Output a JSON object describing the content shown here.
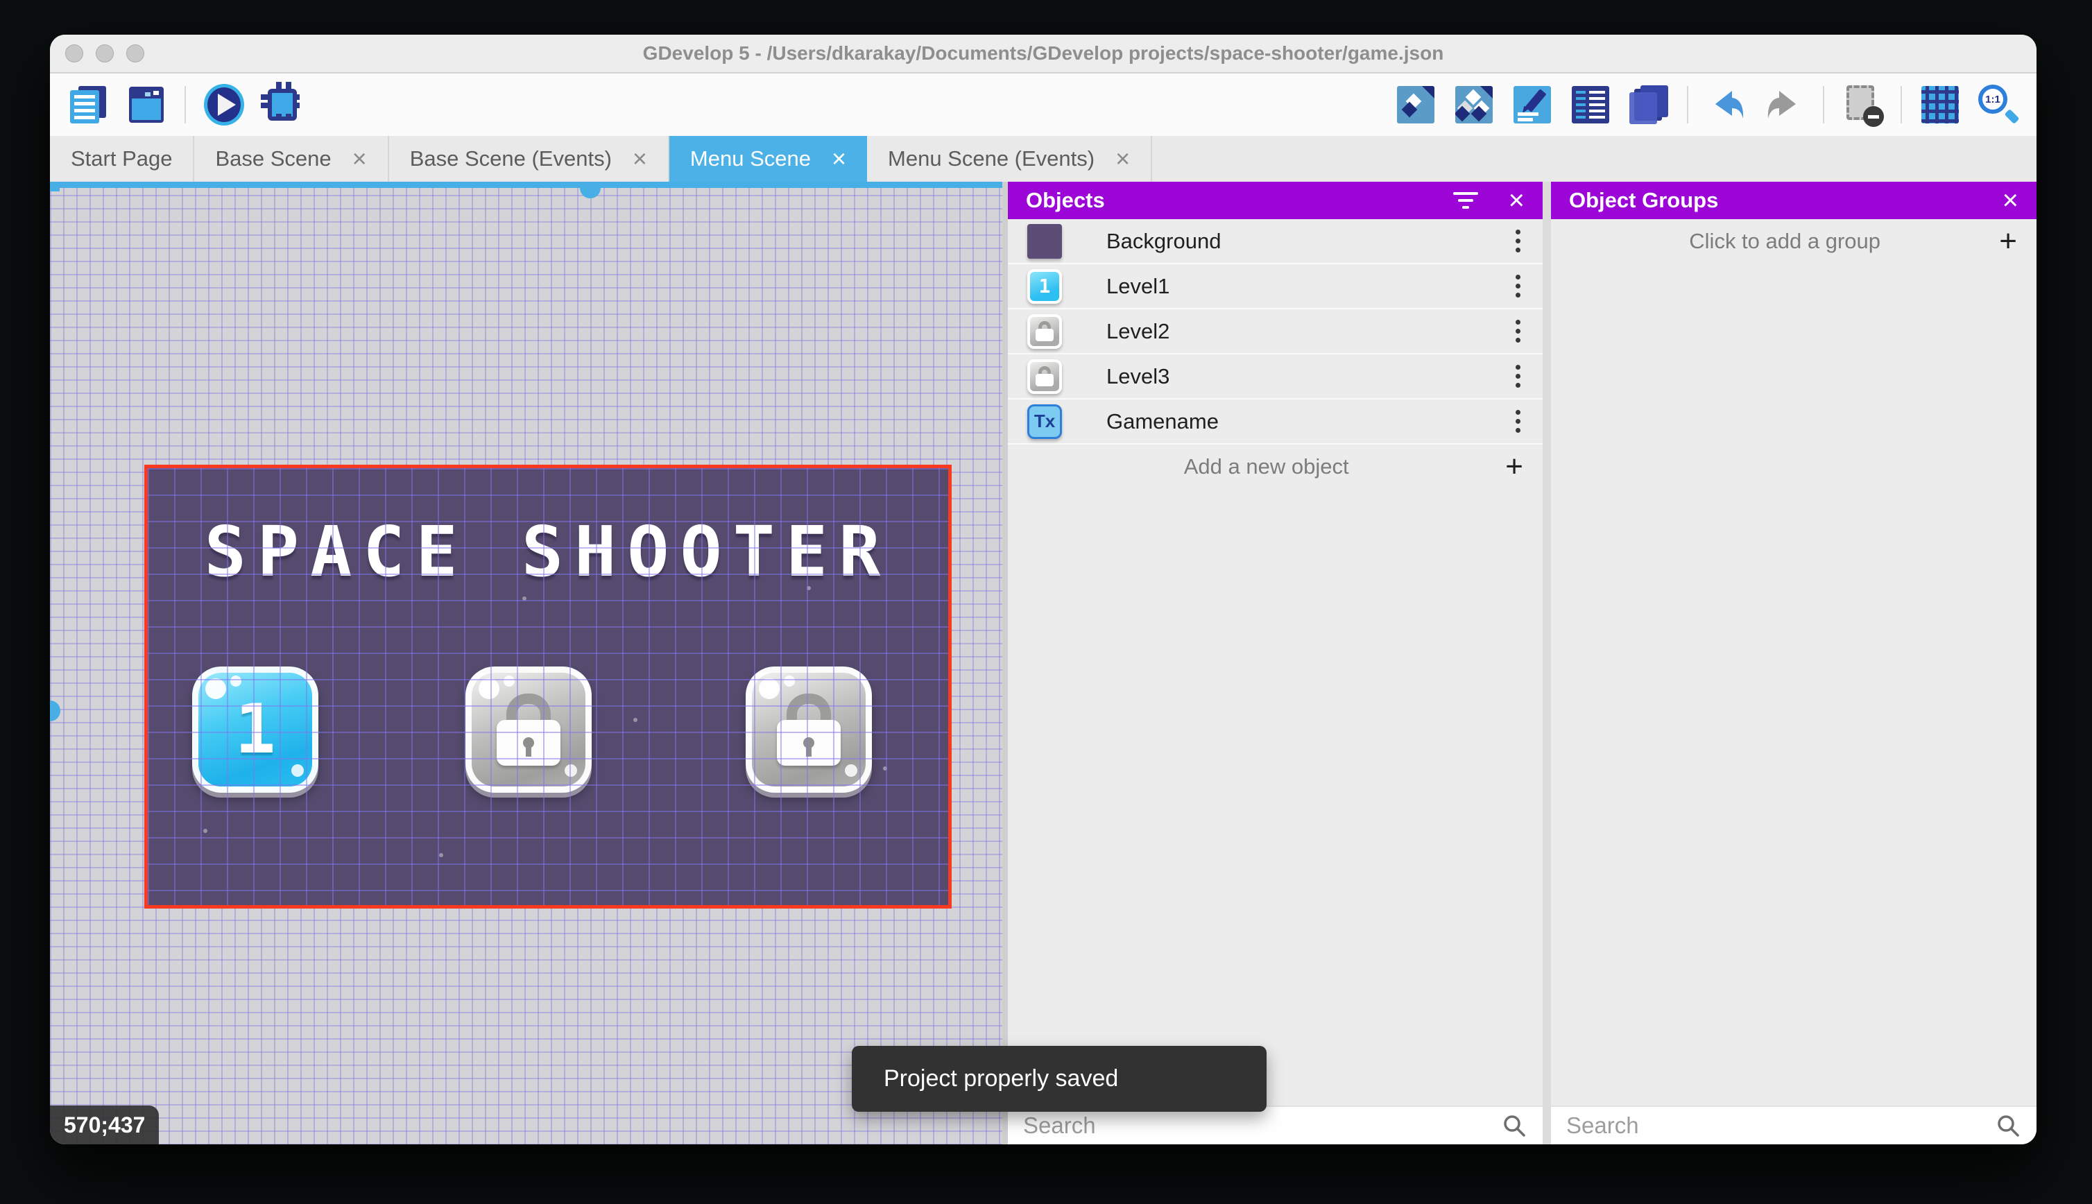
{
  "window": {
    "title": "GDevelop 5 - /Users/dkarakay/Documents/GDevelop projects/space-shooter/game.json",
    "traffic_lights": [
      "close",
      "minimize",
      "zoom"
    ]
  },
  "toolbar": {
    "left_icons": [
      "project-manager-icon",
      "preview-window-icon",
      "play-icon",
      "debug-icon"
    ],
    "right_icons": [
      "object-icon",
      "object-groups-icon",
      "edit-properties-icon",
      "instances-list-icon",
      "layers-icon",
      "undo-icon",
      "redo-icon",
      "mask-icon",
      "grid-icon",
      "zoom-1-1-icon"
    ],
    "zoom_ratio_label": "1:1"
  },
  "tabs": [
    {
      "label": "Start Page",
      "closable": false,
      "active": false
    },
    {
      "label": "Base Scene",
      "closable": true,
      "active": false
    },
    {
      "label": "Base Scene (Events)",
      "closable": true,
      "active": false
    },
    {
      "label": "Menu Scene",
      "closable": true,
      "active": true
    },
    {
      "label": "Menu Scene (Events)",
      "closable": true,
      "active": false
    }
  ],
  "glyphs": {
    "close": "×",
    "plus": "+"
  },
  "canvas": {
    "coordinates": "570;437",
    "toast": "Project properly saved",
    "scene": {
      "title": "SPACE SHOOTER",
      "buttons": [
        {
          "type": "level",
          "label": "1"
        },
        {
          "type": "locked",
          "label": ""
        },
        {
          "type": "locked",
          "label": ""
        }
      ]
    }
  },
  "objects_panel": {
    "title": "Objects",
    "items": [
      {
        "label": "Background",
        "icon": "background-swatch"
      },
      {
        "label": "Level1",
        "icon": "level1-button"
      },
      {
        "label": "Level2",
        "icon": "locked-button"
      },
      {
        "label": "Level3",
        "icon": "locked-button"
      },
      {
        "label": "Gamename",
        "icon": "text-object",
        "thumb_label": "Tx"
      }
    ],
    "add_label": "Add a new object",
    "search_placeholder": "Search"
  },
  "object_groups_panel": {
    "title": "Object Groups",
    "empty_label": "Click to add a group",
    "search_placeholder": "Search"
  },
  "colors": {
    "panel_header_purple": "#9c07d8",
    "active_tab_blue": "#4cb1e7",
    "selection_red": "#f93a20",
    "scene_background": "#564b6e",
    "toast_background": "#323232"
  }
}
